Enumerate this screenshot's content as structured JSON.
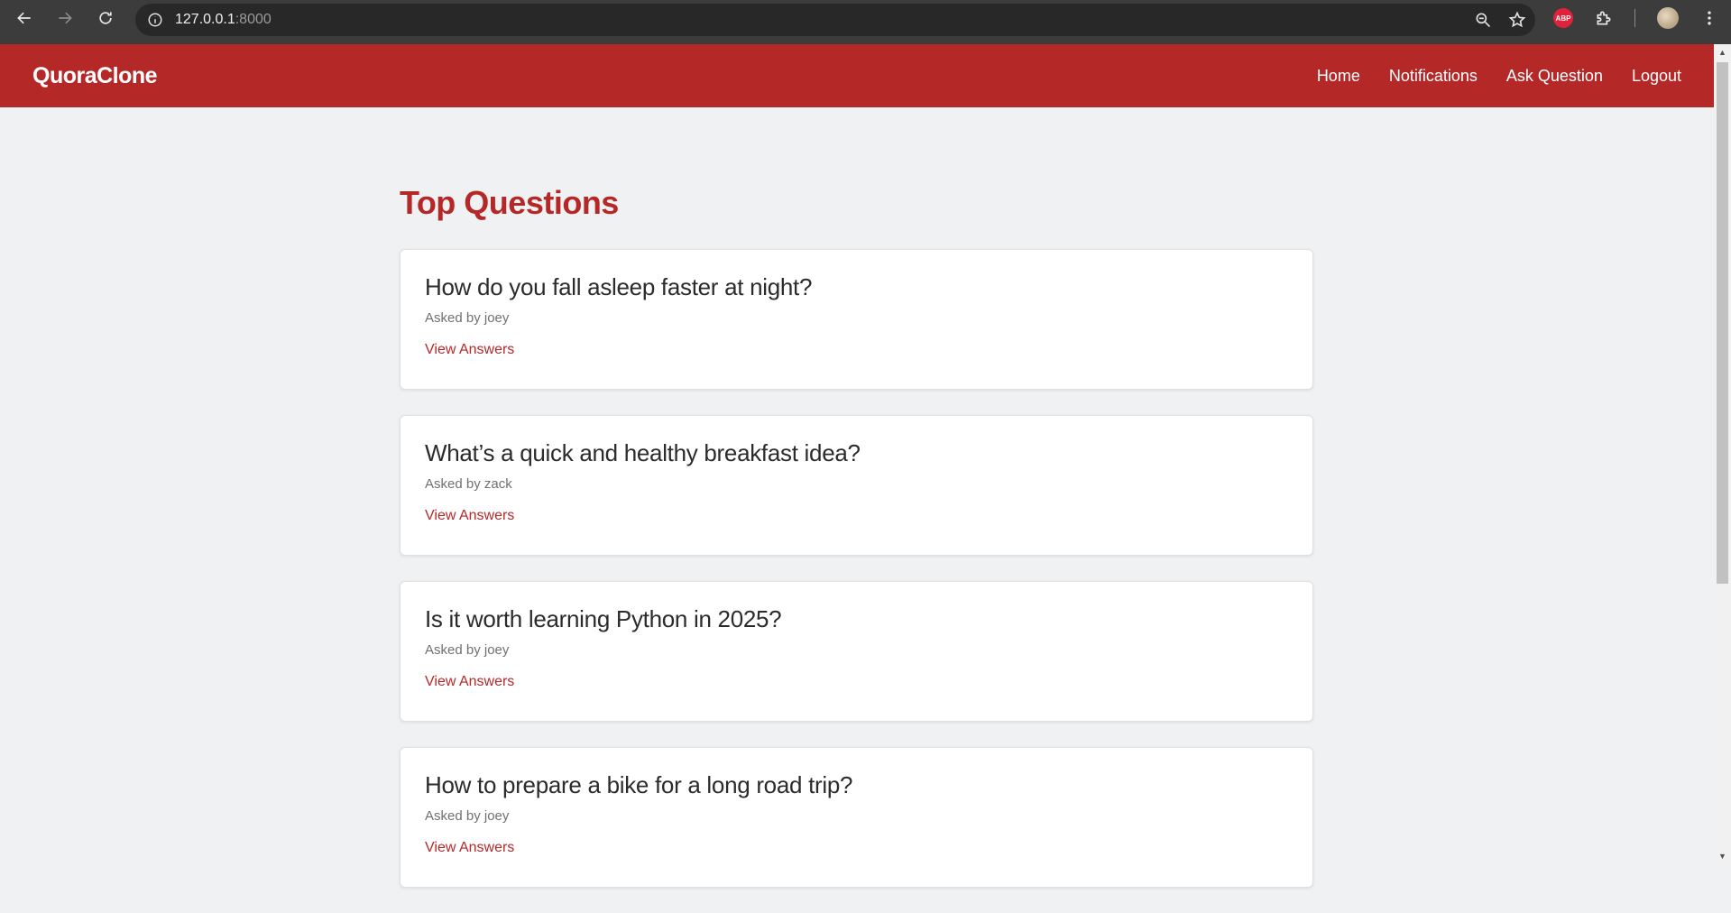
{
  "browser": {
    "url_host": "127.0.0.1",
    "url_port": ":8000",
    "extension_badge": "ABP"
  },
  "header": {
    "brand": "QuoraClone",
    "nav": [
      "Home",
      "Notifications",
      "Ask Question",
      "Logout"
    ]
  },
  "main": {
    "title": "Top Questions",
    "questions": [
      {
        "title": "How do you fall asleep faster at night?",
        "meta": "Asked by joey",
        "link": "View Answers"
      },
      {
        "title": "What’s a quick and healthy breakfast idea?",
        "meta": "Asked by zack",
        "link": "View Answers"
      },
      {
        "title": "Is it worth learning Python in 2025?",
        "meta": "Asked by joey",
        "link": "View Answers"
      },
      {
        "title": "How to prepare a bike for a long road trip?",
        "meta": "Asked by joey",
        "link": "View Answers"
      }
    ]
  },
  "colors": {
    "brand": "#b52828",
    "page_background": "#f0f1f3"
  }
}
